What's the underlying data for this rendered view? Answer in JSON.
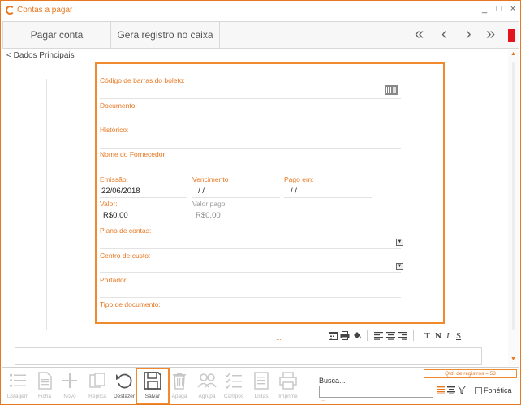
{
  "window": {
    "title": "Contas a pagar",
    "controls": [
      "_",
      "□",
      "×"
    ]
  },
  "toolbar": {
    "buttons": [
      "Pagar conta",
      "Gera registro no caixa"
    ],
    "nav": [
      "«",
      "‹",
      "›",
      "»"
    ]
  },
  "section": {
    "header": "< Dados Principais"
  },
  "form": {
    "barcode_label": "Código de barras do boleto:",
    "documento_label": "Documento:",
    "historico_label": "Histórico:",
    "fornecedor_label": "Nome do Fornecedor:",
    "emissao_label": "Emissão:",
    "emissao_value": "22/06/2018",
    "vencimento_label": "Vencimento",
    "vencimento_value": "/ /",
    "pago_label": "Pago em:",
    "pago_value": "/ /",
    "valor_label": "Valor:",
    "valor_value": "R$0,00",
    "valor_pago_label": "Valor pago:",
    "valor_pago_value": "R$0,00",
    "plano_label": "Plano de contas:",
    "centro_label": "Centro de custo:",
    "portador_label": "Portador",
    "tipo_label": "Tipo de documento:"
  },
  "format_toolbar": {
    "dots": "...",
    "text_buttons": [
      "T",
      "N",
      "I",
      "S"
    ]
  },
  "bottom": {
    "buttons": [
      {
        "label": "Listagem",
        "icon": "list-icon",
        "active": false
      },
      {
        "label": "Ficha",
        "icon": "document-icon",
        "active": false
      },
      {
        "label": "Novo",
        "icon": "plus-icon",
        "active": false
      },
      {
        "label": "Replica",
        "icon": "copy-icon",
        "active": false
      },
      {
        "label": "Desfazer",
        "icon": "undo-icon",
        "active": true
      },
      {
        "label": "Salvar",
        "icon": "save-icon",
        "active": true
      },
      {
        "label": "Apaga",
        "icon": "trash-icon",
        "active": false
      },
      {
        "label": "Agrupa",
        "icon": "users-icon",
        "active": false
      },
      {
        "label": "Campos",
        "icon": "checklist-icon",
        "active": false
      },
      {
        "label": "Listas",
        "icon": "lists-icon",
        "active": false
      },
      {
        "label": "Imprime",
        "icon": "printer-icon",
        "active": false
      }
    ],
    "busca_label": "Busca...",
    "busca_value": "",
    "busca_dots": "...",
    "qtd_registros": "Qtd. de registros = 53",
    "fonetica_label": "Fonética",
    "fonetica_checked": false
  },
  "colors": {
    "accent": "#e87722",
    "highlight_border": "#f08a2c",
    "flag": "#e3141b"
  }
}
